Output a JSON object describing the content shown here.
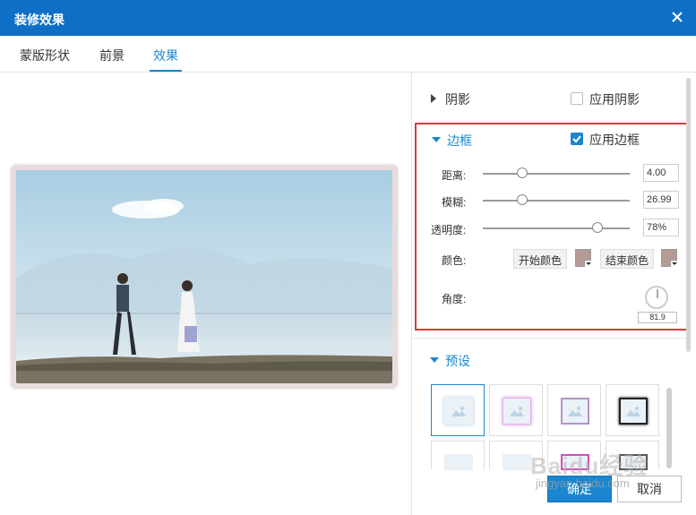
{
  "window": {
    "title": "装修效果"
  },
  "tabs": [
    {
      "label": "蒙版形状"
    },
    {
      "label": "前景"
    },
    {
      "label": "效果"
    }
  ],
  "shadow_section": {
    "title": "阴影",
    "checkbox_label": "应用阴影",
    "checked": false
  },
  "border_section": {
    "title": "边框",
    "checkbox_label": "应用边框",
    "checked": true,
    "distance": {
      "label": "距离:",
      "value": "4.00",
      "level": 0.27
    },
    "blur": {
      "label": "模糊:",
      "value": "26.99",
      "level": 0.27
    },
    "opacity": {
      "label": "透明度:",
      "value": "78%",
      "level": 0.78
    },
    "color": {
      "label": "颜色:",
      "start_label": "开始颜色",
      "end_label": "结束颜色",
      "start_color": "#b49c95",
      "end_color": "#b49c95"
    },
    "angle": {
      "label": "角度:",
      "value": "81.9"
    }
  },
  "presets_section": {
    "title": "预设"
  },
  "buttons": {
    "confirm": "确定",
    "cancel": "取消"
  },
  "watermark": {
    "main": "Baidu经验",
    "sub": "jingyan.baidu.com"
  },
  "colors": {
    "titlebar": "#0f6fc6",
    "accent": "#1a86d0",
    "highlight_border": "#d9383a"
  }
}
